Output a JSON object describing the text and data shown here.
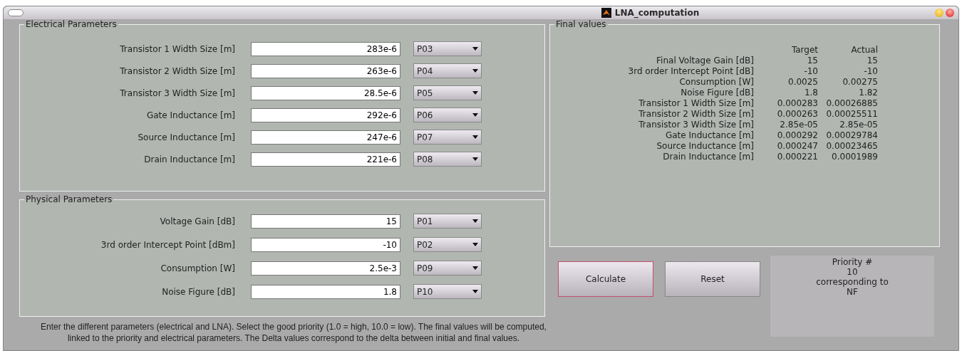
{
  "window": {
    "title": "LNA_computation"
  },
  "electrical_parameters": {
    "title": "Electrical Parameters",
    "rows": [
      {
        "label": "Transistor 1 Width Size [m]",
        "value": "283e-6",
        "priority": "P03"
      },
      {
        "label": "Transistor 2 Width Size [m]",
        "value": "263e-6",
        "priority": "P04"
      },
      {
        "label": "Transistor 3 Width Size [m]",
        "value": "28.5e-6",
        "priority": "P05"
      },
      {
        "label": "Gate Inductance [m]",
        "value": "292e-6",
        "priority": "P06"
      },
      {
        "label": "Source Inductance [m]",
        "value": "247e-6",
        "priority": "P07"
      },
      {
        "label": "Drain Inductance [m]",
        "value": "221e-6",
        "priority": "P08"
      }
    ]
  },
  "physical_parameters": {
    "title": "Physical Parameters",
    "rows": [
      {
        "label": "Voltage Gain [dB]",
        "value": "15",
        "priority": "P01"
      },
      {
        "label": "3rd order Intercept Point [dBm]",
        "value": "-10",
        "priority": "P02"
      },
      {
        "label": "Consumption [W]",
        "value": "2.5e-3",
        "priority": "P09"
      },
      {
        "label": "Noise Figure [dB]",
        "value": "1.8",
        "priority": "P10"
      }
    ]
  },
  "help_text": [
    "Enter the different parameters (electrical and LNA). Select the good priority (1.0 = high, 10.0 = low). The final values will be computed,",
    "linked to the priority and electrical parameters. The Delta values correspond to the delta between initial and final values."
  ],
  "final_values": {
    "title": "Final values",
    "columns": [
      "Target",
      "Actual"
    ],
    "rows": [
      {
        "label": "Final Voltage Gain [dB]",
        "target": "15",
        "actual": "15"
      },
      {
        "label": "3rd order Intercept Point [dB]",
        "target": "-10",
        "actual": "-10"
      },
      {
        "label": "Consumption [W]",
        "target": "0.0025",
        "actual": "0.00275"
      },
      {
        "label": "Noise Figure [dB]",
        "target": "1.8",
        "actual": "1.82"
      },
      {
        "label": "Transistor 1 Width Size [m]",
        "target": "0.000283",
        "actual": "0.00026885"
      },
      {
        "label": "Transistor 2 Width Size [m]",
        "target": "0.000263",
        "actual": "0.00025511"
      },
      {
        "label": "Transistor 3 Width Size [m]",
        "target": "2.85e-05",
        "actual": "2.85e-05"
      },
      {
        "label": "Gate Inductance [m]",
        "target": "0.000292",
        "actual": "0.00029784"
      },
      {
        "label": "Source Inductance [m]",
        "target": "0.000247",
        "actual": "0.00023465"
      },
      {
        "label": "Drain Inductance [m]",
        "target": "0.000221",
        "actual": "0.0001989"
      }
    ]
  },
  "buttons": [
    {
      "label": "Calculate",
      "focused": true
    },
    {
      "label": "Reset",
      "focused": false
    }
  ],
  "priority_info": [
    "Priority #",
    "10",
    "corresponding to",
    "NF"
  ]
}
